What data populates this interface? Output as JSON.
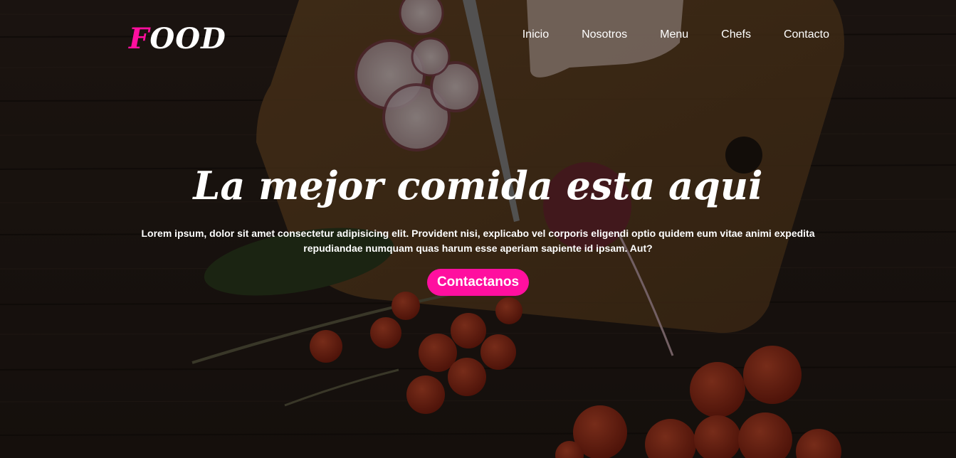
{
  "brand": {
    "logo_first_letter": "F",
    "logo_rest": "OOD",
    "accent_color": "#ff0f9f"
  },
  "nav": {
    "items": [
      {
        "label": "Inicio"
      },
      {
        "label": "Nosotros"
      },
      {
        "label": "Menu"
      },
      {
        "label": "Chefs"
      },
      {
        "label": "Contacto"
      }
    ]
  },
  "hero": {
    "title": "La mejor comida esta aqui",
    "text": "Lorem ipsum, dolor sit amet consectetur adipisicing elit. Provident nisi, explicabo vel corporis eligendi optio quidem eum vitae animi expedita repudiandae numquam quas harum esse aperiam sapiente id ipsam. Aut?",
    "cta_label": "Contactanos",
    "background_image": "cutting-board-radish-tomatoes-image"
  }
}
